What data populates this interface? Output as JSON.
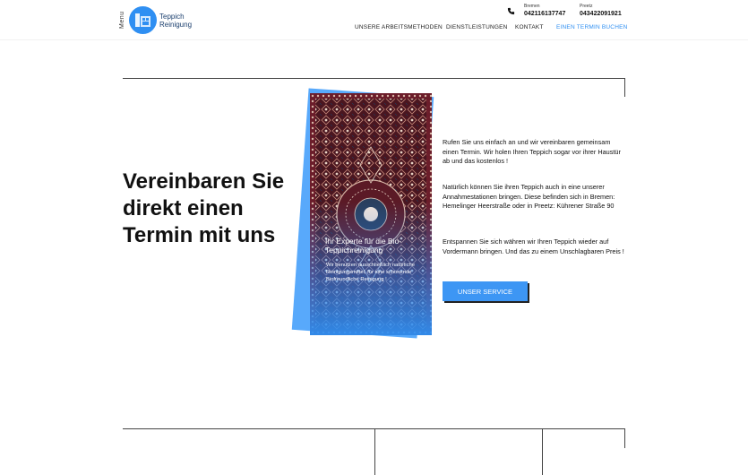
{
  "header": {
    "menu_label": "Menu",
    "logo_line1": "Teppich",
    "logo_line2": "Reinigung",
    "contacts": [
      {
        "city": "Bremen",
        "phone": "042116137747"
      },
      {
        "city": "Preetz",
        "phone": "043422091921"
      }
    ],
    "nav": [
      {
        "label": "UNSERE ARBEITSMETHODEN"
      },
      {
        "label": "DIENSTLEISTUNGEN"
      },
      {
        "label": "KONTAKT"
      },
      {
        "label": "EINEN TERMIN BUCHEN"
      }
    ]
  },
  "hero": {
    "headline": "Vereinbaren Sie direkt einen Termin mit uns"
  },
  "card": {
    "title": "Ihr Experte für die Bio-Teppichreinigung",
    "text": "Wir benutzen ausschließlich natürliche Reinigungsmittel, für eine schonende Biofreundliche Reinigung !"
  },
  "content": {
    "p1": "Rufen Sie uns einfach an und wir vereinbaren gemeinsam einen Termin. Wir holen Ihren Teppich sogar vor ihrer Haustür ab und das kostenlos !",
    "p2": "Natürlich können Sie ihren Teppich auch in eine unserer Annahmestationen bringen. Diese befinden sich in Bremen: Hemelinger Heerstraße oder in Preetz: Kührener Straße 90",
    "p3": "Entspannen Sie sich währen wir Ihren Teppich wieder auf Vordermann bringen. Und das zu einem Unschlagbaren Preis !",
    "button": "UNSER SERVICE"
  },
  "colors": {
    "accent": "#2f8ff2",
    "button": "#3d96f4",
    "rug_base": "#5a1a24"
  },
  "icons": [
    "phone-icon",
    "logo-icon"
  ]
}
